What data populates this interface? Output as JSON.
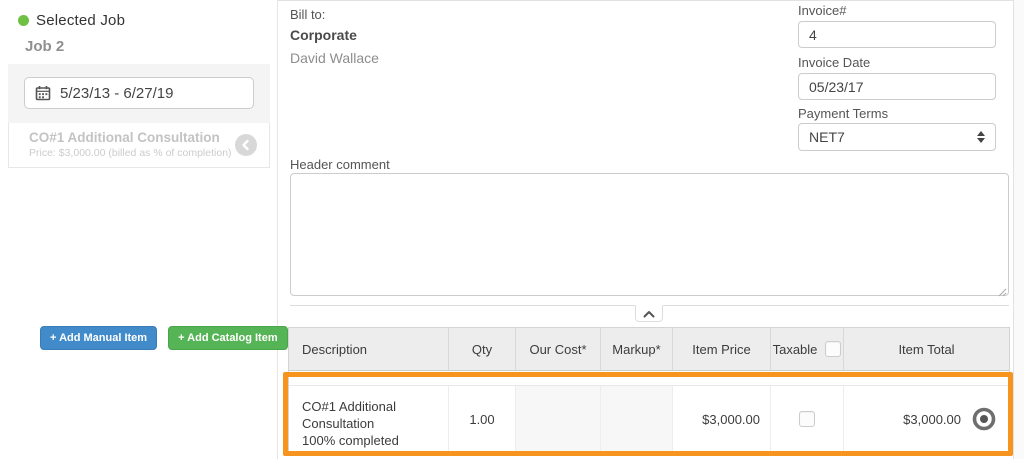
{
  "sidebar": {
    "selected_job_label": "Selected Job",
    "job_name": "Job 2",
    "date_range": "5/23/13 - 6/27/19",
    "job_card": {
      "title": "CO#1 Additional Consultation",
      "subtitle": "Price: $3,000.00 (billed as % of completion)"
    },
    "buttons": {
      "add_manual": "+ Add Manual Item",
      "add_catalog": "+ Add Catalog Item"
    }
  },
  "invoice": {
    "bill_to_label": "Bill to:",
    "bill_to_company": "Corporate",
    "bill_to_contact": "David Wallace",
    "invoice_number_label": "Invoice#",
    "invoice_number": "4",
    "invoice_date_label": "Invoice Date",
    "invoice_date": "05/23/17",
    "payment_terms_label": "Payment Terms",
    "payment_terms": "NET7",
    "header_comment_label": "Header comment",
    "header_comment": ""
  },
  "items_table": {
    "columns": [
      "Description",
      "Qty",
      "Our Cost*",
      "Markup*",
      "Item Price",
      "Taxable",
      "Item Total"
    ],
    "rows": [
      {
        "description": "CO#1 Additional Consultation",
        "description_note": "100% completed",
        "qty": "1.00",
        "our_cost": "",
        "markup": "",
        "item_price": "$3,000.00",
        "taxable_checked": false,
        "item_total": "$3,000.00"
      }
    ]
  },
  "colors": {
    "highlight_orange": "#f7941e",
    "add_manual_blue": "#428bca",
    "add_catalog_green": "#55b455",
    "selected_job_dot": "#6fc143"
  }
}
